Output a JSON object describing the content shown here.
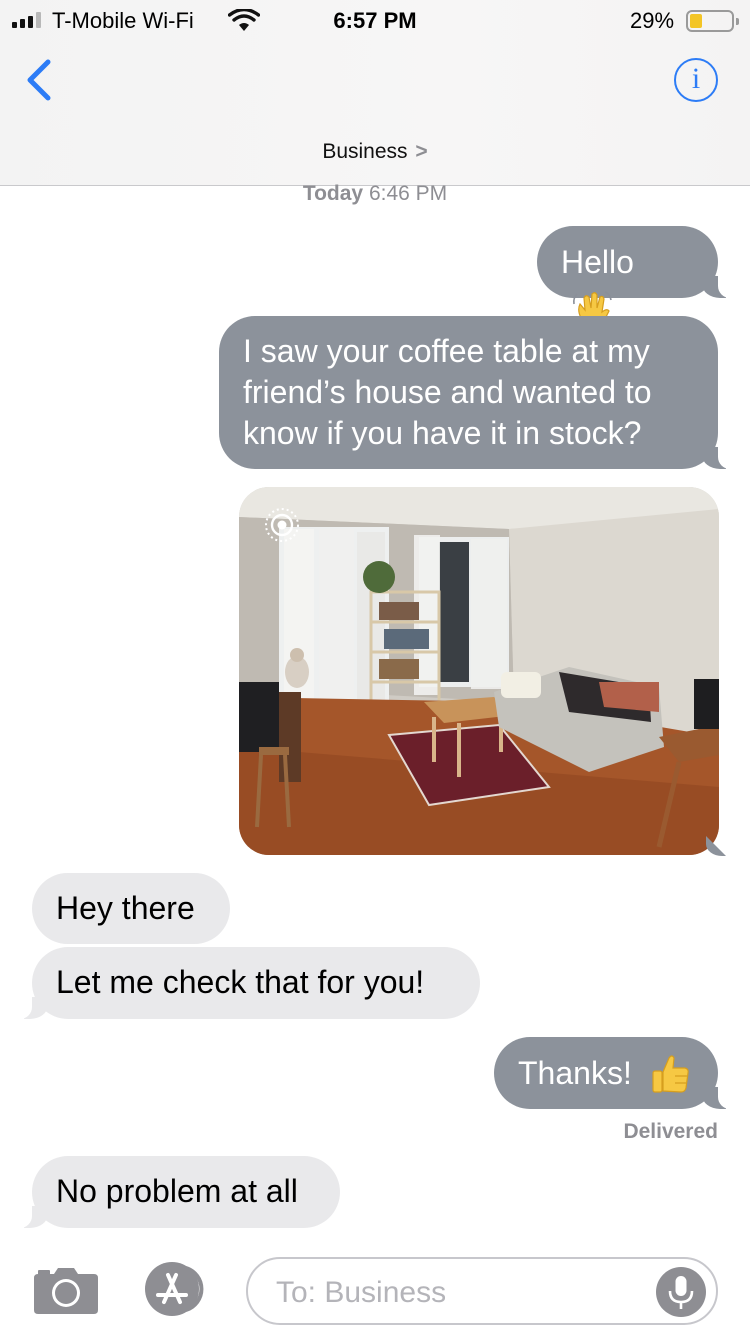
{
  "status_bar": {
    "carrier": "T-Mobile Wi-Fi",
    "time": "6:57 PM",
    "battery_percent": "29%",
    "battery_level": 0.29,
    "battery_color": "#f3c525"
  },
  "nav": {
    "contact_name": "Business",
    "contact_chevron": ">",
    "info_glyph": "i",
    "back_icon": "chevron-left-icon",
    "accent_color": "#2c7cf6"
  },
  "thread": {
    "timestamp_day": "Today",
    "timestamp_time": "6:46 PM",
    "messages": [
      {
        "direction": "outgoing",
        "type": "text",
        "text": "Hello",
        "emoji": "waving-hand"
      },
      {
        "direction": "outgoing",
        "type": "text",
        "text": "I saw your coffee table at my friend’s house and wanted to know if you have it in stock?"
      },
      {
        "direction": "outgoing",
        "type": "live-photo",
        "content": "living room with coffee table, sofa, rug and shelves"
      },
      {
        "direction": "incoming",
        "type": "text",
        "text": "Hey there"
      },
      {
        "direction": "incoming",
        "type": "text",
        "text": "Let me check that for you!"
      },
      {
        "direction": "outgoing",
        "type": "text",
        "text": "Thanks!",
        "emoji": "thumbs-up"
      },
      {
        "direction": "incoming",
        "type": "text",
        "text": "No problem at all"
      }
    ],
    "delivery_status": "Delivered",
    "outgoing_color": "#8c929b",
    "incoming_color": "#e9e9eb"
  },
  "composer": {
    "placeholder": "To: Business",
    "camera_icon": "camera-icon",
    "apps_icon": "app-store-icon",
    "mic_icon": "microphone-icon"
  }
}
